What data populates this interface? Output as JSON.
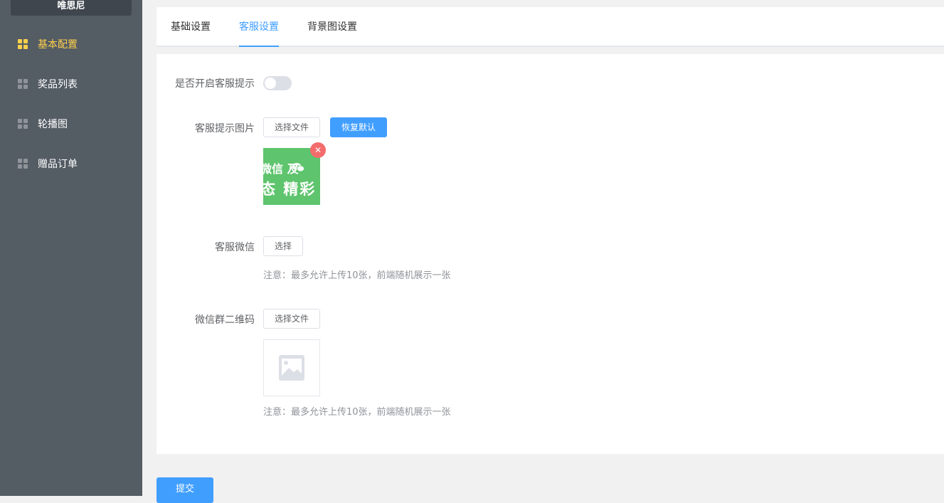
{
  "sidebar": {
    "brand": "唯思尼",
    "items": [
      {
        "label": "基本配置",
        "icon": "grid-icon",
        "active": true
      },
      {
        "label": "奖品列表",
        "icon": "grid-icon",
        "active": false
      },
      {
        "label": "轮播图",
        "icon": "grid-icon",
        "active": false
      },
      {
        "label": "赠品订单",
        "icon": "grid-icon",
        "active": false
      }
    ]
  },
  "tabs": [
    {
      "label": "基础设置"
    },
    {
      "label": "客服设置"
    },
    {
      "label": "背景图设置"
    }
  ],
  "active_tab": 1,
  "form": {
    "service_tip": {
      "label": "是否开启客服提示",
      "enabled": false
    },
    "tip_image": {
      "label": "客服提示图片",
      "choose_label": "选择文件",
      "reset_label": "恢复默认",
      "thumb_line1": "微信 及",
      "thumb_line2": "态 精彩"
    },
    "wechat": {
      "label": "客服微信",
      "choose_label": "选择",
      "note": "注意：最多允许上传10张，前端随机展示一张"
    },
    "group_qr": {
      "label": "微信群二维码",
      "choose_label": "选择文件",
      "note": "注意：最多允许上传10张，前端随机展示一张"
    }
  },
  "submit_label": "提交",
  "colors": {
    "accent": "#409eff",
    "sidebar_bg": "#545c64",
    "active_menu": "#ffd04b",
    "danger": "#f56c6c"
  }
}
